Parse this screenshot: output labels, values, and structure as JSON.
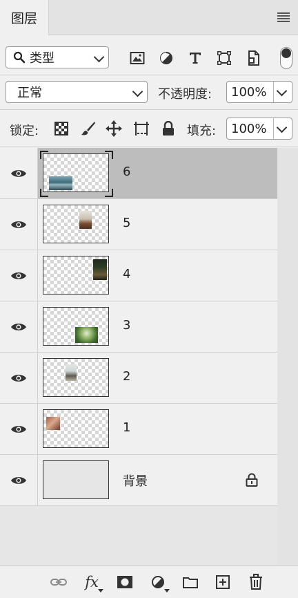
{
  "panel": {
    "tab_title": "图层"
  },
  "filter": {
    "kind_label": "类型"
  },
  "blend": {
    "mode": "正常",
    "opacity_label": "不透明度:",
    "opacity_value": "100%"
  },
  "lock": {
    "lock_label": "锁定:",
    "fill_label": "填充:",
    "fill_value": "100%"
  },
  "layers": [
    {
      "name": "6",
      "selected": true
    },
    {
      "name": "5"
    },
    {
      "name": "4"
    },
    {
      "name": "3"
    },
    {
      "name": "2"
    },
    {
      "name": "1"
    },
    {
      "name": "背景",
      "locked": true
    }
  ],
  "colors": {
    "selected_row": "#bdbdbd",
    "panel_bg": "#f0f0f0"
  }
}
